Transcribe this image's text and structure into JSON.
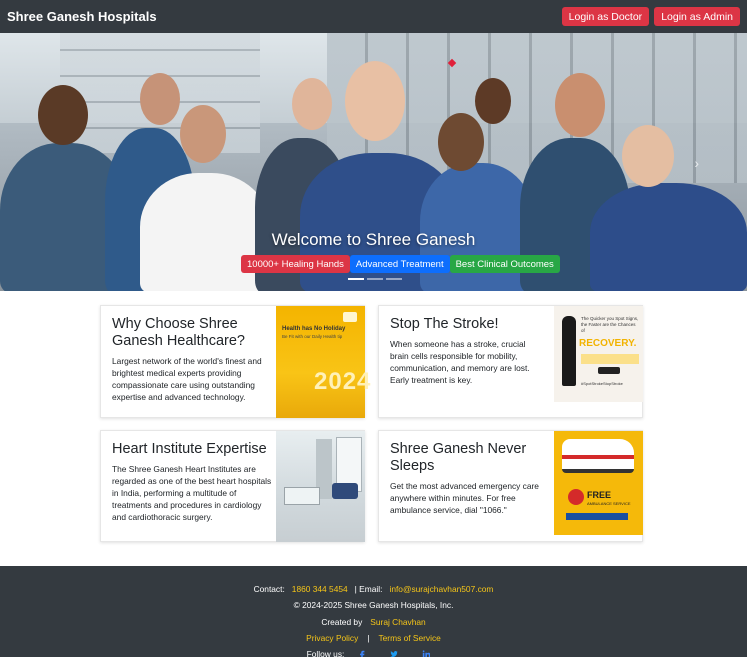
{
  "navbar": {
    "brand": "Shree Ganesh Hospitals",
    "login_doctor": "Login as Doctor",
    "login_admin": "Login as Admin"
  },
  "hero": {
    "title": "Welcome to Shree Ganesh",
    "badges": [
      "10000+ Healing Hands",
      "Advanced Treatment",
      "Best Clinical Outcomes"
    ],
    "slides": 3,
    "active_slide": 1
  },
  "cards": [
    {
      "title": "Why Choose Shree Ganesh Healthcare?",
      "text": "Largest network of the world's finest and brightest medical experts providing compassionate care using outstanding expertise and advanced technology.",
      "image": {
        "headline": "Health has No Holiday",
        "sub": "Be Fit with our Daily Health tip",
        "year": "2024"
      }
    },
    {
      "title": "Stop The Stroke!",
      "text": "When someone has a stroke, crucial brain cells responsible for mobility, communication, and memory are lost. Early treatment is key.",
      "image": {
        "question": "The Quicker you Spot Signs, the Faster are the Chances of",
        "headline": "RECOVERY.",
        "tag": "#SpotStrokeStopStroke"
      }
    },
    {
      "title": "Heart Institute Expertise",
      "text": "The Shree Ganesh Heart Institutes are regarded as one of the best heart hospitals in India, performing a multitude of treatments and procedures in cardiology and cardiothoracic surgery.",
      "image": {}
    },
    {
      "title": "Shree Ganesh Never Sleeps",
      "text": "Get the most advanced emergency care anywhere within minutes. For free ambulance service, dial \"1066.\"",
      "image": {
        "number": "1066",
        "headline": "FREE",
        "sub": "AMBULANCE SERVICE"
      }
    }
  ],
  "footer": {
    "contact_label": "Contact:",
    "phone": "1860 344 5454",
    "email_label": "| Email:",
    "email": "info@surajchavhan507.com",
    "copyright": "© 2024-2025 Shree Ganesh Hospitals, Inc.",
    "created_label": "Created by",
    "creator": "Suraj Chavhan",
    "privacy": "Privacy Policy",
    "sep": "|",
    "terms": "Terms of Service",
    "follow": "Follow us:"
  },
  "colors": {
    "navbar": "#343a40",
    "danger": "#dc3545",
    "primary": "#0d6efd",
    "success": "#28a745",
    "link_yellow": "#f5c518"
  }
}
